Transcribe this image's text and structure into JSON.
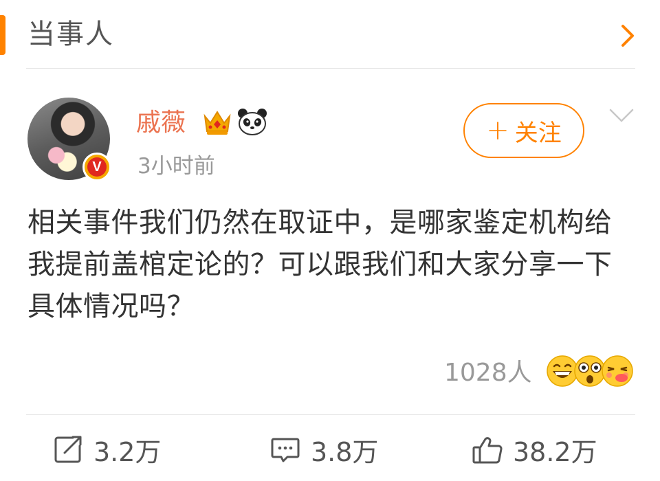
{
  "section": {
    "title": "当事人"
  },
  "post": {
    "author": "戚薇",
    "time": "3小时前",
    "follow_label": "关注",
    "follow_plus": "+",
    "text": "相关事件我们仍然在取证中，是哪家鉴定机构给我提前盖棺定论的？可以跟我们和大家分享一下具体情况吗？",
    "reaction_count": "1028人",
    "reaction_icons": [
      "grin-emoji-icon",
      "shocked-emoji-icon",
      "blush-emoji-icon"
    ]
  },
  "actions": {
    "repost": "3.2万",
    "comment": "3.8万",
    "like": "38.2万"
  },
  "colors": {
    "accent": "#ff8200",
    "username": "#eb7350",
    "muted": "#999999"
  }
}
